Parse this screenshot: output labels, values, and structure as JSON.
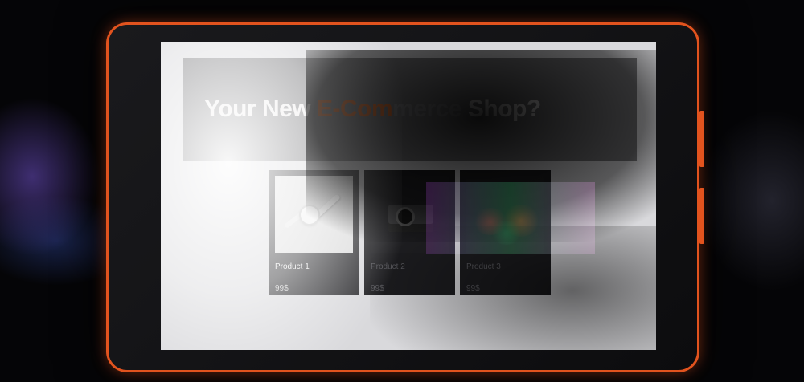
{
  "hero": {
    "title_part1": "Your New ",
    "title_accent": "E-Com",
    "title_muted": "merce",
    "title_part2": " Shop?"
  },
  "products": [
    {
      "name": "Product 1",
      "price": "99$",
      "image": "smartwatch-image"
    },
    {
      "name": "Product 2",
      "price": "99$",
      "image": "camera-image"
    },
    {
      "name": "Product 3",
      "price": "99$",
      "image": "colorful-abstract-image"
    }
  ],
  "colors": {
    "accent": "#e2661f",
    "device_frame": "#e2531e",
    "card_bg": "#303033",
    "screen_bg": "#d9d9dc"
  }
}
